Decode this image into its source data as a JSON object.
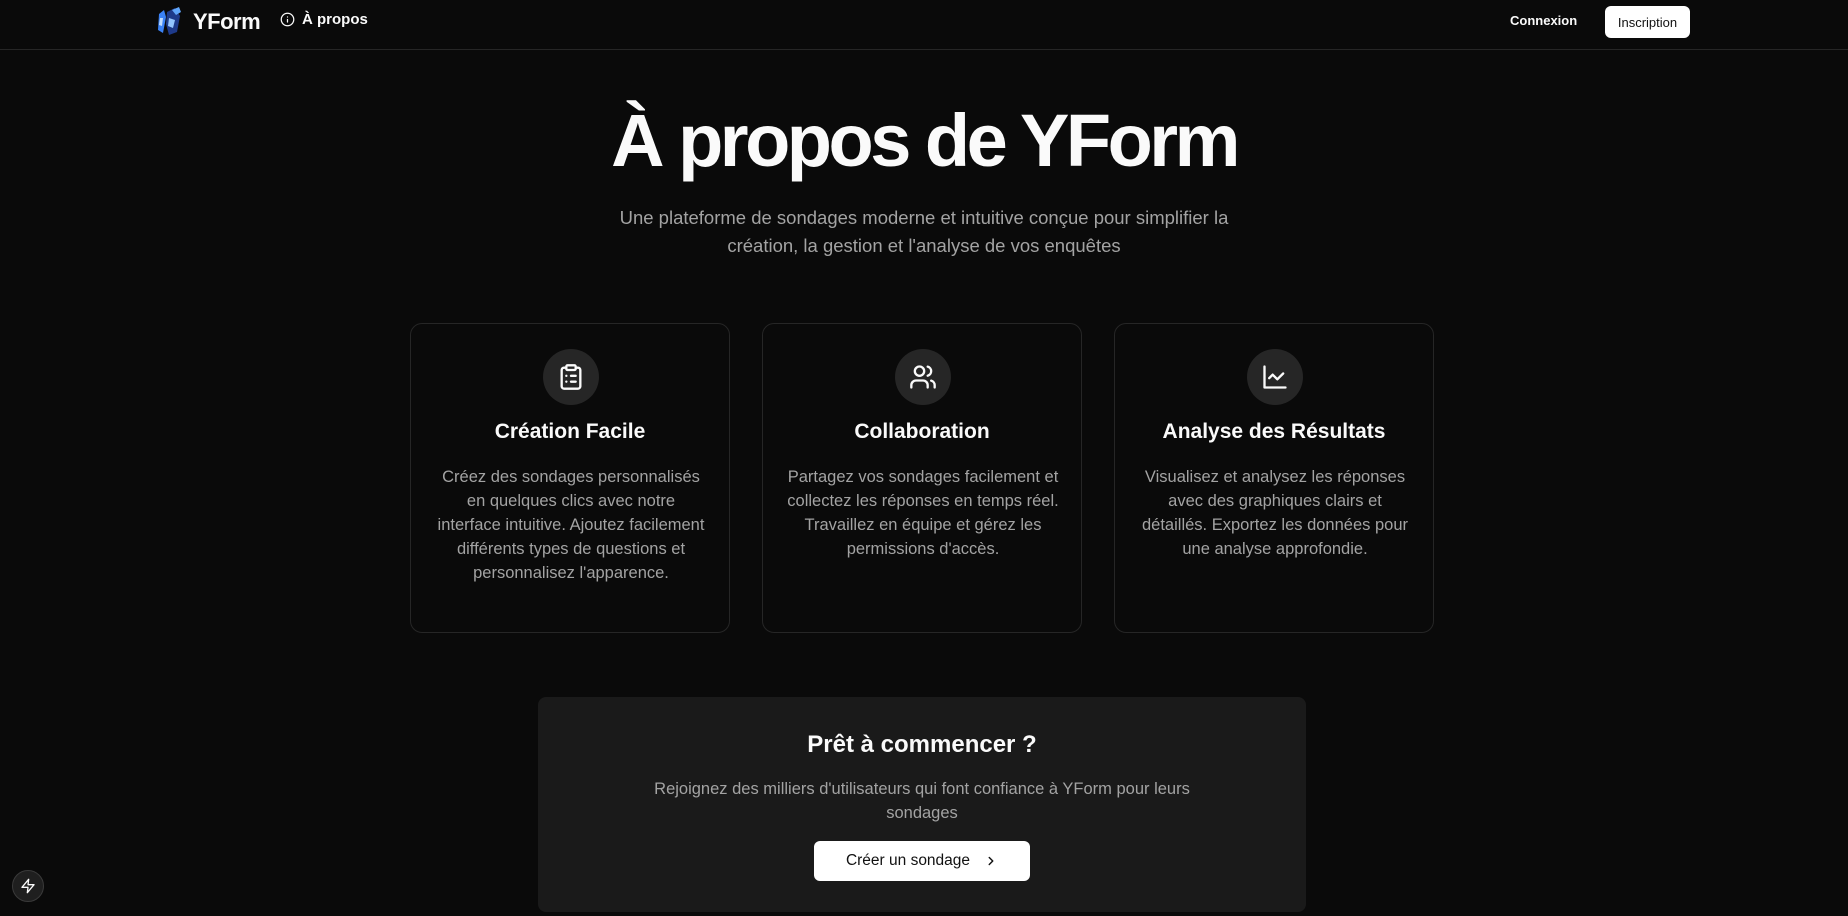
{
  "header": {
    "brand_name": "YForm",
    "nav": {
      "about_label": "À propos"
    },
    "login_label": "Connexion",
    "signup_label": "Inscription"
  },
  "hero": {
    "title": "À propos de YForm",
    "subtitle": "Une plateforme de sondages moderne et intuitive conçue pour simplifier la création, la gestion et l'analyse de vos enquêtes"
  },
  "features": [
    {
      "icon": "clipboard-list-icon",
      "title": "Création Facile",
      "description": "Créez des sondages personnalisés en quelques clics avec notre interface intuitive. Ajoutez facilement différents types de questions et personnalisez l'apparence."
    },
    {
      "icon": "users-icon",
      "title": "Collaboration",
      "description": "Partagez vos sondages facilement et collectez les réponses en temps réel. Travaillez en équipe et gérez les permissions d'accès."
    },
    {
      "icon": "line-chart-icon",
      "title": "Analyse des Résultats",
      "description": "Visualisez et analysez les réponses avec des graphiques clairs et détaillés. Exportez les données pour une analyse approfondie."
    }
  ],
  "cta": {
    "title": "Prêt à commencer ?",
    "description": "Rejoignez des milliers d'utilisateurs qui font confiance à YForm pour leurs sondages",
    "button_label": "Créer un sondage"
  },
  "colors": {
    "background": "#0a0a0a",
    "card_border": "#262626",
    "icon_bg": "#262626",
    "muted_text": "#a3a3a3",
    "cta_bg": "#1a1a1a",
    "button_bg": "#ffffff"
  }
}
